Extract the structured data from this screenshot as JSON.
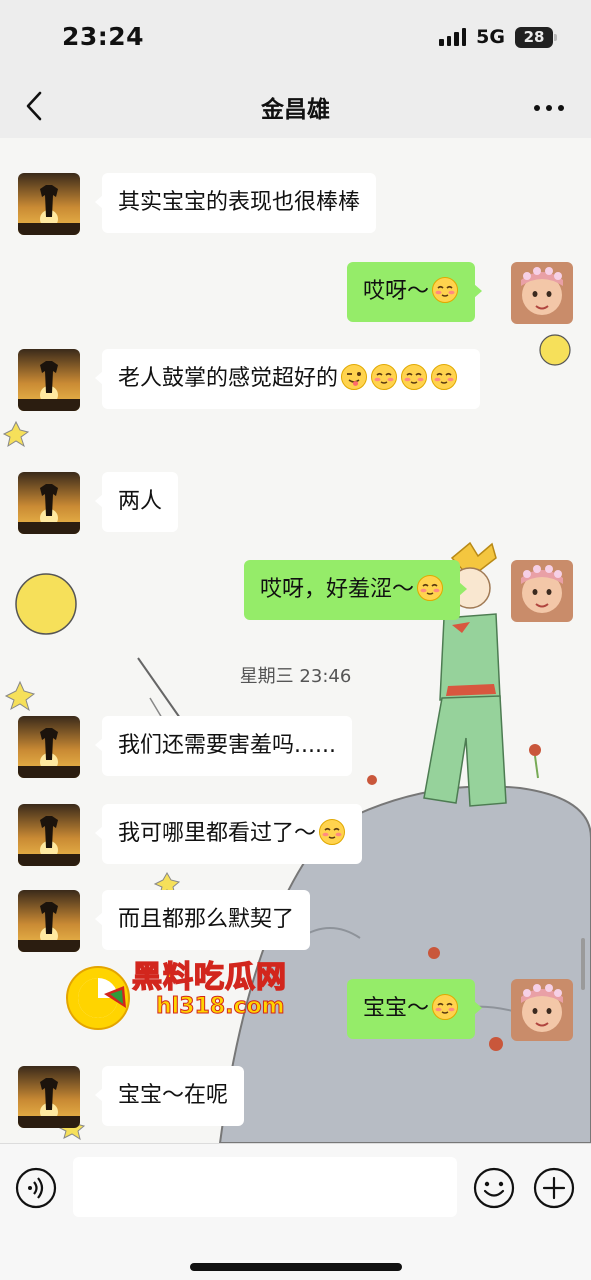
{
  "status_bar": {
    "time": "23:24",
    "network": "5G",
    "battery": "28"
  },
  "header": {
    "title": "金昌雄"
  },
  "messages": [
    {
      "side": "left",
      "text": "其实宝宝的表现也很棒棒",
      "emojis": []
    },
    {
      "side": "right",
      "text": "哎呀～",
      "emojis": [
        "shy-blush-emoji"
      ]
    },
    {
      "side": "left",
      "text": "老人鼓掌的感觉超好的",
      "emojis": [
        "wink-tongue-emoji",
        "shy-blush-emoji",
        "shy-blush-emoji",
        "shy-blush-emoji"
      ]
    },
    {
      "side": "left",
      "text": "两人",
      "emojis": []
    },
    {
      "side": "right",
      "text": "哎呀，好羞涩～",
      "emojis": [
        "shy-blush-emoji"
      ]
    },
    {
      "side": "left",
      "text": "我们还需要害羞吗......",
      "emojis": []
    },
    {
      "side": "left",
      "text": "我可哪里都看过了～",
      "emojis": [
        "shy-blush-emoji"
      ]
    },
    {
      "side": "left",
      "text": "而且都那么默契了",
      "emojis": []
    },
    {
      "side": "right",
      "text": "宝宝～",
      "emojis": [
        "shy-blush-emoji"
      ]
    },
    {
      "side": "left",
      "text": "宝宝～在呢",
      "emojis": []
    }
  ],
  "timestamp": "星期三 23:46",
  "watermark": {
    "title": "黑料吃瓜网",
    "url": "hl318.com"
  },
  "input": {
    "placeholder": ""
  },
  "colors": {
    "sent_bubble": "#95ec69",
    "received_bubble": "#ffffff",
    "background": "#ededed"
  }
}
